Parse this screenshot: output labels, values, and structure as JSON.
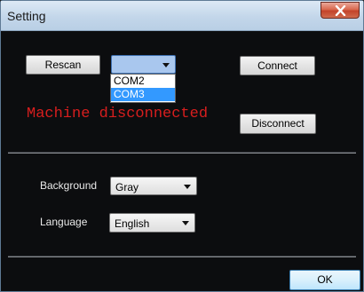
{
  "window": {
    "title": "Setting"
  },
  "port": {
    "rescan_label": "Rescan",
    "connect_label": "Connect",
    "disconnect_label": "Disconnect",
    "selected": "",
    "options": [
      "COM2",
      "COM3"
    ],
    "highlighted": "COM3",
    "status": "Machine disconnected",
    "status_color": "#d81e1e"
  },
  "settings": {
    "background_label": "Background",
    "background_value": "Gray",
    "language_label": "Language",
    "language_value": "English"
  },
  "footer": {
    "ok_label": "OK"
  },
  "icons": {
    "close": "close-icon",
    "dropdown": "chevron-down-icon"
  }
}
